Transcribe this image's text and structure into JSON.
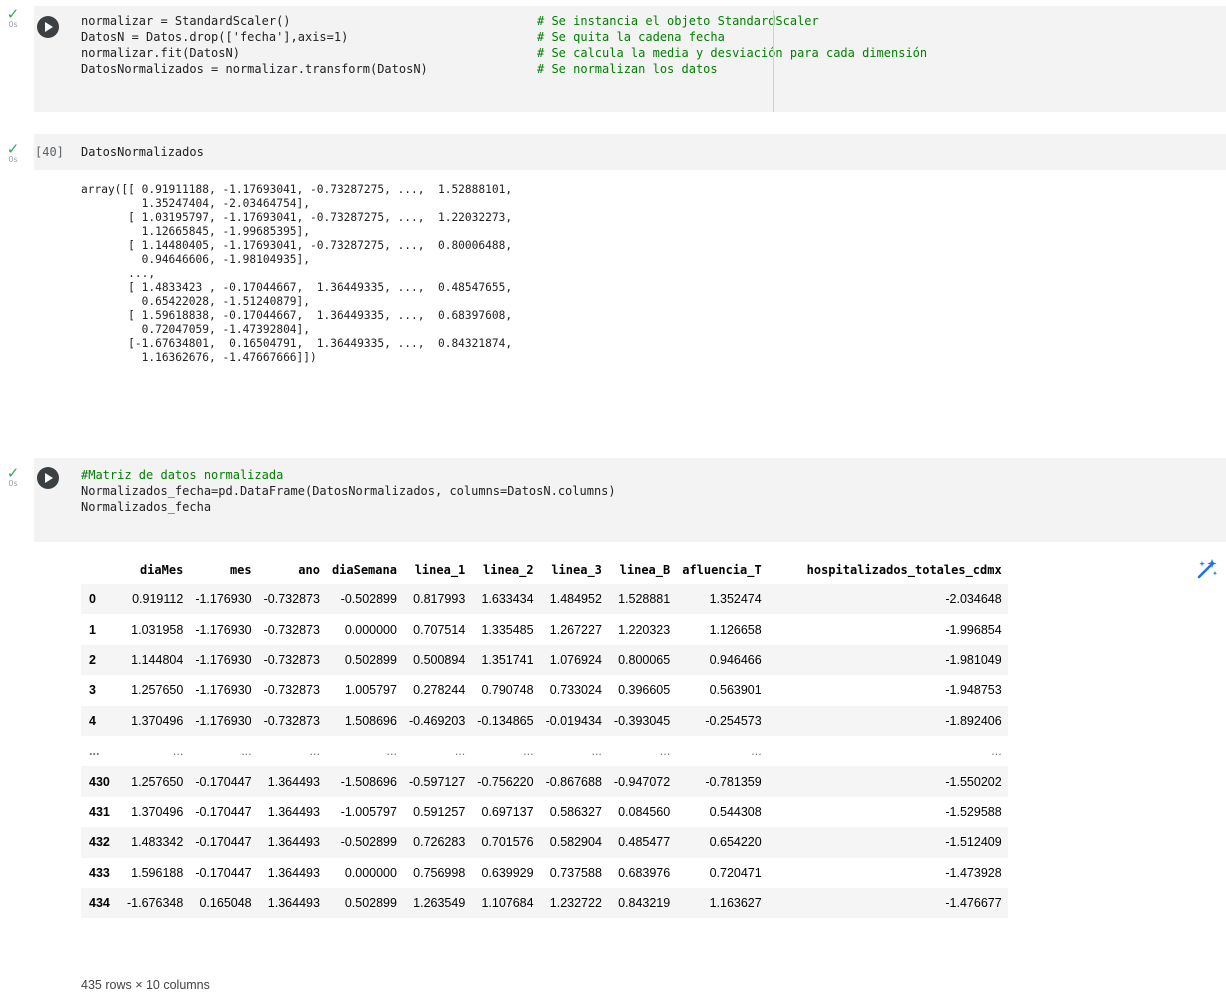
{
  "cells": [
    {
      "status": "✓",
      "duration": "0s",
      "code_lines": [
        "normalizar = StandardScaler()",
        "DatosN = Datos.drop(['fecha'],axis=1)",
        "normalizar.fit(DatosN)",
        "DatosNormalizados = normalizar.transform(DatosN)"
      ],
      "comment_lines": [
        "# Se instancia el objeto StandardScaler",
        "# Se quita la cadena fecha",
        "# Se calcula la media y desviación para cada dimensión",
        "# Se normalizan los datos"
      ]
    },
    {
      "status": "✓",
      "duration": "0s",
      "exec_count": "[40]",
      "code": "DatosNormalizados",
      "output": "array([[ 0.91911188, -1.17693041, -0.73287275, ...,  1.52888101,\n         1.35247404, -2.03464754],\n       [ 1.03195797, -1.17693041, -0.73287275, ...,  1.22032273,\n         1.12665845, -1.99685395],\n       [ 1.14480405, -1.17693041, -0.73287275, ...,  0.80006488,\n         0.94646606, -1.98104935],\n       ...,\n       [ 1.4833423 , -0.17044667,  1.36449335, ...,  0.48547655,\n         0.65422028, -1.51240879],\n       [ 1.59618838, -0.17044667,  1.36449335, ...,  0.68397608,\n         0.72047059, -1.47392804],\n       [-1.67634801,  0.16504791,  1.36449335, ...,  0.84321874,\n         1.16362676, -1.47667666]])"
    },
    {
      "status": "✓",
      "duration": "0s",
      "code_lines": [
        "#Matriz de datos normalizada",
        "Normalizados_fecha=pd.DataFrame(DatosNormalizados, columns=DatosN.columns)",
        "Normalizados_fecha"
      ]
    }
  ],
  "dataframe": {
    "columns": [
      "",
      "diaMes",
      "mes",
      "ano",
      "diaSemana",
      "linea_1",
      "linea_2",
      "linea_3",
      "linea_B",
      "afluencia_T",
      "hospitalizados_totales_cdmx"
    ],
    "rows": [
      [
        "0",
        "0.919112",
        "-1.176930",
        "-0.732873",
        "-0.502899",
        "0.817993",
        "1.633434",
        "1.484952",
        "1.528881",
        "1.352474",
        "-2.034648"
      ],
      [
        "1",
        "1.031958",
        "-1.176930",
        "-0.732873",
        "0.000000",
        "0.707514",
        "1.335485",
        "1.267227",
        "1.220323",
        "1.126658",
        "-1.996854"
      ],
      [
        "2",
        "1.144804",
        "-1.176930",
        "-0.732873",
        "0.502899",
        "0.500894",
        "1.351741",
        "1.076924",
        "0.800065",
        "0.946466",
        "-1.981049"
      ],
      [
        "3",
        "1.257650",
        "-1.176930",
        "-0.732873",
        "1.005797",
        "0.278244",
        "0.790748",
        "0.733024",
        "0.396605",
        "0.563901",
        "-1.948753"
      ],
      [
        "4",
        "1.370496",
        "-1.176930",
        "-0.732873",
        "1.508696",
        "-0.469203",
        "-0.134865",
        "-0.019434",
        "-0.393045",
        "-0.254573",
        "-1.892406"
      ],
      [
        "...",
        "...",
        "...",
        "...",
        "...",
        "...",
        "...",
        "...",
        "...",
        "...",
        "..."
      ],
      [
        "430",
        "1.257650",
        "-0.170447",
        "1.364493",
        "-1.508696",
        "-0.597127",
        "-0.756220",
        "-0.867688",
        "-0.947072",
        "-0.781359",
        "-1.550202"
      ],
      [
        "431",
        "1.370496",
        "-0.170447",
        "1.364493",
        "-1.005797",
        "0.591257",
        "0.697137",
        "0.586327",
        "0.084560",
        "0.544308",
        "-1.529588"
      ],
      [
        "432",
        "1.483342",
        "-0.170447",
        "1.364493",
        "-0.502899",
        "0.726283",
        "0.701576",
        "0.582904",
        "0.485477",
        "0.654220",
        "-1.512409"
      ],
      [
        "433",
        "1.596188",
        "-0.170447",
        "1.364493",
        "0.000000",
        "0.756998",
        "0.639929",
        "0.737588",
        "0.683976",
        "0.720471",
        "-1.473928"
      ],
      [
        "434",
        "-1.676348",
        "0.165048",
        "1.364493",
        "0.502899",
        "1.263549",
        "1.107684",
        "1.232722",
        "0.843219",
        "1.163627",
        "-1.476677"
      ]
    ],
    "shape_note": "435 rows × 10 columns"
  }
}
